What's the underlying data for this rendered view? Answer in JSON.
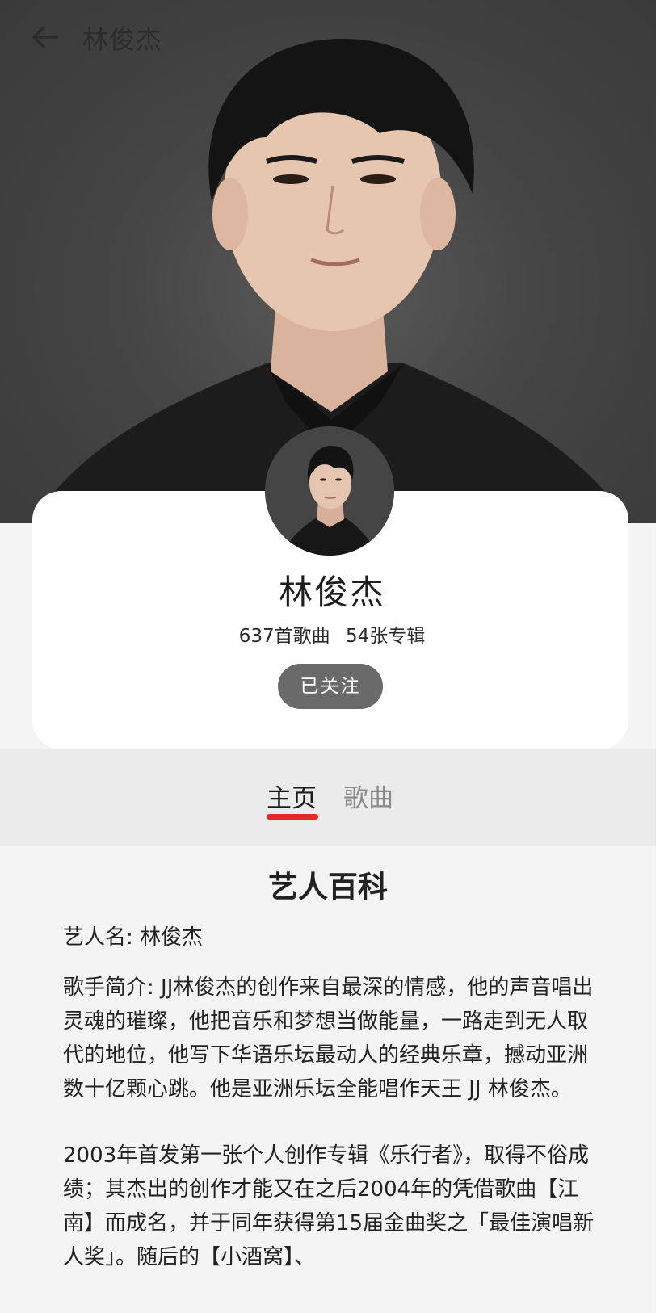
{
  "topbar": {
    "back_icon": "arrow-left-icon",
    "title": "林俊杰"
  },
  "artist": {
    "name": "林俊杰",
    "song_count": "637首歌曲",
    "album_count": "54张专辑",
    "follow_label": "已关注"
  },
  "tabs": [
    {
      "label": "主页",
      "active": true
    },
    {
      "label": "歌曲",
      "active": false
    }
  ],
  "wiki": {
    "title": "艺人百科",
    "name_line": "艺人名: 林俊杰",
    "bio_1": "歌手简介: JJ林俊杰的创作来自最深的情感，他的声音唱出灵魂的璀璨，他把音乐和梦想当做能量，一路走到无人取代的地位，他写下华语乐坛最动人的经典乐章，撼动亚洲数十亿颗心跳。他是亚洲乐坛全能唱作天王 JJ 林俊杰。",
    "bio_2": "2003年首发第一张个人创作专辑《乐行者》，取得不俗成绩；其杰出的创作才能又在之后2004年的凭借歌曲【江南】而成名，并于同年获得第15届金曲奖之「最佳演唱新人奖」。随后的【小酒窝】、"
  },
  "colors": {
    "accent": "#e8262a",
    "follow_button": "#6a6a6a",
    "hero_background": "#454545"
  }
}
